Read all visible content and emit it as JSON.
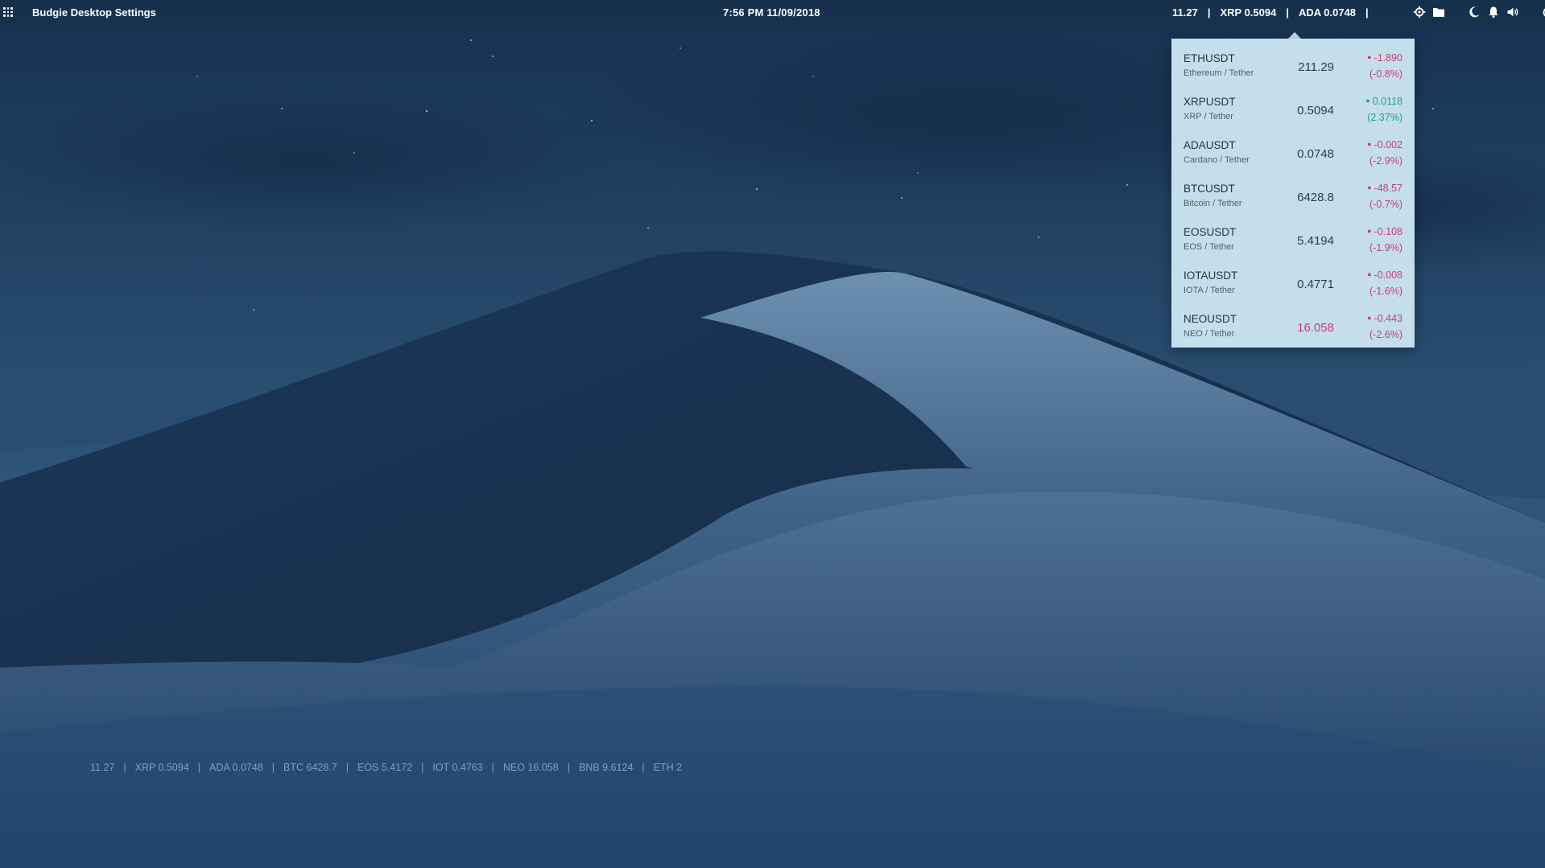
{
  "panel": {
    "window_title": "Budgie Desktop Settings",
    "clock": "7:56 PM  11/09/2018",
    "ticker": [
      "11.27",
      "XRP 0.5094",
      "ADA 0.0748"
    ],
    "separator": "|",
    "tray_icons": [
      "settings-icon",
      "folder-icon",
      "night-light-icon",
      "notifications-icon",
      "volume-icon",
      "power-icon",
      "logout-icon"
    ]
  },
  "popover": {
    "coins": [
      {
        "symbol": "ETHUSDT",
        "name": "Ethereum / Tether",
        "price": "211.29",
        "change": "-1.890",
        "pct": "(-0.8%)",
        "direction": "down"
      },
      {
        "symbol": "XRPUSDT",
        "name": "XRP / Tether",
        "price": "0.5094",
        "change": "0.0118",
        "pct": "(2.37%)",
        "direction": "up"
      },
      {
        "symbol": "ADAUSDT",
        "name": "Cardano / Tether",
        "price": "0.0748",
        "change": "-0.002",
        "pct": "(-2.9%)",
        "direction": "down"
      },
      {
        "symbol": "BTCUSDT",
        "name": "Bitcoin / Tether",
        "price": "6428.8",
        "change": "-48.57",
        "pct": "(-0.7%)",
        "direction": "down"
      },
      {
        "symbol": "EOSUSDT",
        "name": "EOS / Tether",
        "price": "5.4194",
        "change": "-0.108",
        "pct": "(-1.9%)",
        "direction": "down"
      },
      {
        "symbol": "IOTAUSDT",
        "name": "IOTA / Tether",
        "price": "0.4771",
        "change": "-0.008",
        "pct": "(-1.6%)",
        "direction": "down"
      },
      {
        "symbol": "NEOUSDT",
        "name": "NEO / Tether",
        "price": "16.058",
        "change": "-0.443",
        "pct": "(-2.6%)",
        "direction": "down",
        "price_alert": true
      }
    ]
  },
  "desktop_ticker": [
    "11.27",
    "XRP 0.5094",
    "ADA 0.0748",
    "BTC 6428.7",
    "EOS 5.4172",
    "IOT 0.4763",
    "NEO 16.058",
    "BNB 9.6124",
    "ETH 2"
  ],
  "colors": {
    "popover_bg": "#c5deec",
    "negative": "#c4436f",
    "positive": "#21a08d",
    "panel_text": "#ffffff",
    "desktop_ticker_text": "#7fa1bf"
  }
}
